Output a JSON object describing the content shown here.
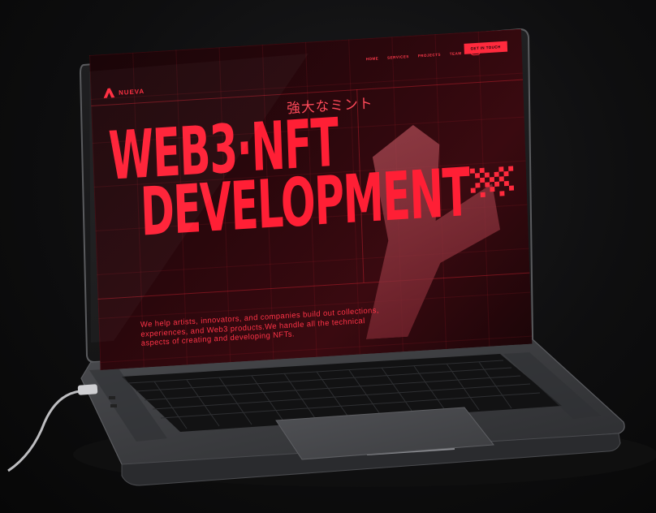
{
  "site": {
    "brand": "NUEVA",
    "nav": [
      {
        "label": "HOME"
      },
      {
        "label": "SERVICES"
      },
      {
        "label": "PROJECTS"
      },
      {
        "label": "TEAM"
      }
    ],
    "cta_label": "GET IN TOUCH",
    "headline_line1": "WEB3·NFT",
    "headline_line2": "DEVELOPMENT",
    "japanese_tagline": "強大なミント",
    "description": "We help artists, innovators, and companies build out collections, experiences, and Web3 products.We handle all the technical aspects of creating and developing NFTs.",
    "colors": {
      "accent": "#ff2a3d",
      "background": "#1a0508",
      "device": "#3a3b3e"
    },
    "icons": [
      "logo-mark-icon",
      "theme-toggle-icon",
      "pixel-art-icon",
      "3d-logo-shape"
    ]
  }
}
